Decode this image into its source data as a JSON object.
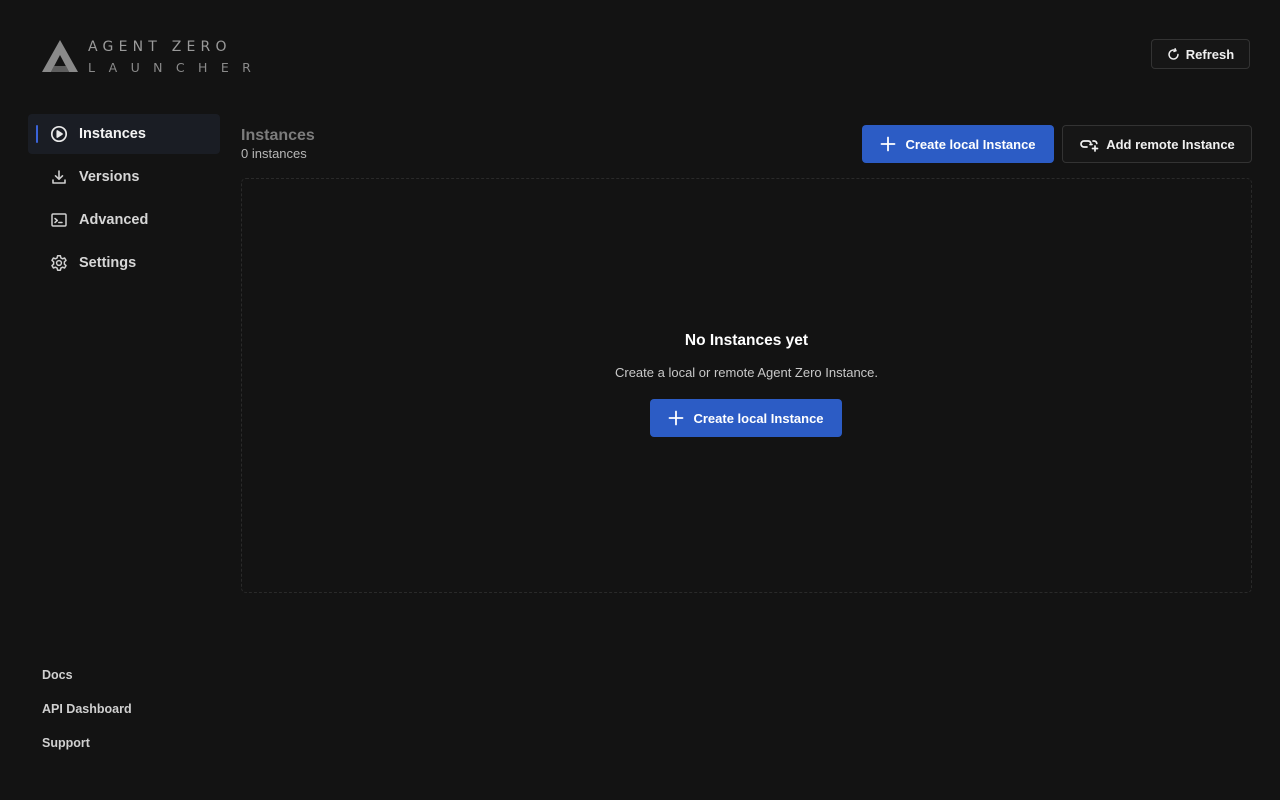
{
  "logo": {
    "line1": "AGENT ZERO",
    "line2": "LAUNCHER",
    "icon": "agent-zero-logo-icon"
  },
  "header": {
    "refresh_label": "Refresh",
    "refresh_icon": "refresh-icon"
  },
  "sidebar": {
    "items": [
      {
        "label": "Instances",
        "icon": "play-circle-icon",
        "active": true
      },
      {
        "label": "Versions",
        "icon": "download-icon",
        "active": false
      },
      {
        "label": "Advanced",
        "icon": "terminal-icon",
        "active": false
      },
      {
        "label": "Settings",
        "icon": "gear-icon",
        "active": false
      }
    ]
  },
  "footer": {
    "links": [
      "Docs",
      "API Dashboard",
      "Support"
    ]
  },
  "main": {
    "title": "Instances",
    "count": "0 instances",
    "create_local_label": "Create local Instance",
    "add_remote_label": "Add remote Instance"
  },
  "empty_state": {
    "title": "No Instances yet",
    "subtitle": "Create a local or remote Agent Zero Instance.",
    "button_label": "Create local Instance"
  },
  "colors": {
    "background": "#131313",
    "accent": "#2c5cc5",
    "active_indicator": "#3a63d8"
  }
}
